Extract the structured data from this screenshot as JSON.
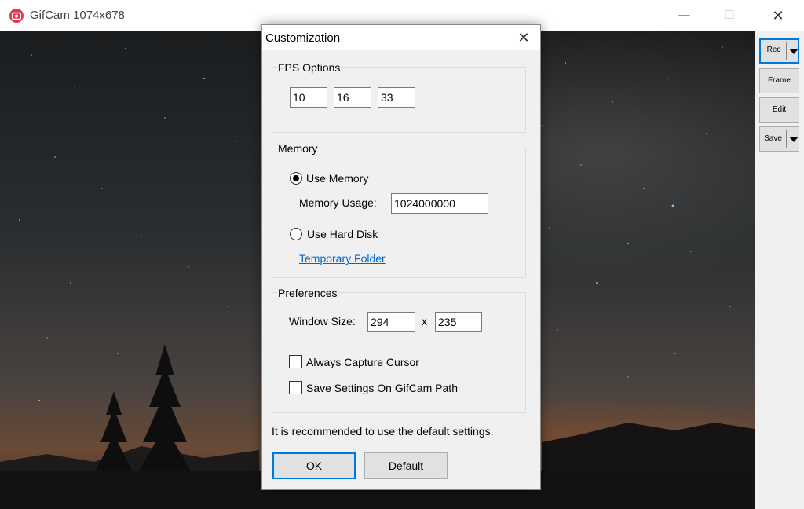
{
  "window": {
    "title": "GifCam 1074x678",
    "minimize_glyph": "—",
    "maximize_glyph": "☐",
    "close_glyph": "✕"
  },
  "sidebar": {
    "rec_label": "Rec",
    "frame_label": "Frame",
    "edit_label": "Edit",
    "save_label": "Save"
  },
  "dialog": {
    "title": "Customization",
    "close_glyph": "✕",
    "fps": {
      "label": "FPS Options",
      "values": [
        "10",
        "16",
        "33"
      ]
    },
    "memory": {
      "label": "Memory",
      "use_memory_label": "Use Memory",
      "use_memory_selected": true,
      "usage_label": "Memory Usage:",
      "usage_value": "1024000000",
      "use_hard_disk_label": "Use Hard Disk",
      "temp_folder_link": "Temporary Folder"
    },
    "preferences": {
      "label": "Preferences",
      "window_size_label": "Window Size:",
      "width": "294",
      "times": "x",
      "height": "235",
      "always_capture_cursor_label": "Always Capture Cursor",
      "always_capture_cursor_checked": false,
      "save_settings_label": "Save Settings On GifCam Path",
      "save_settings_checked": false
    },
    "note": "It is recommended to use the default settings.",
    "ok_label": "OK",
    "default_label": "Default"
  },
  "colors": {
    "accent": "#0078d7",
    "app_icon": "#e8344e",
    "link": "#0066cc"
  }
}
